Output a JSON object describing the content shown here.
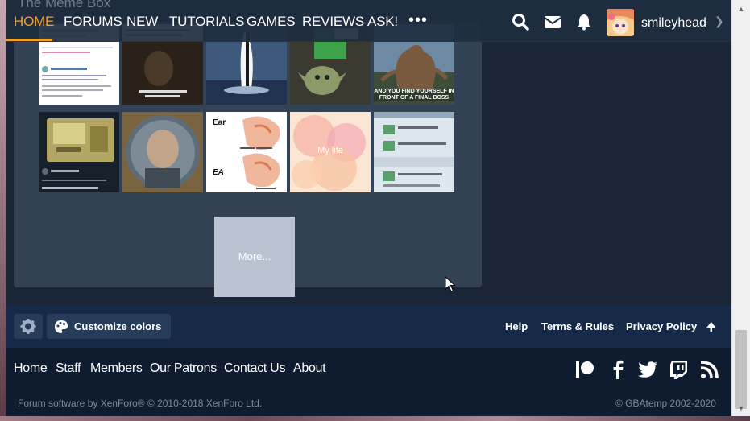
{
  "behind_title": "The Meme Box",
  "nav": {
    "items": [
      "HOME",
      "FORUMS",
      "NEW",
      "TUTORIALS",
      "GAMES",
      "REVIEWS",
      "ASK!"
    ],
    "more_glyph": "•••",
    "username": "smileyhead",
    "icons": [
      "search-icon",
      "envelope-icon",
      "bell-icon"
    ]
  },
  "panel": {
    "more_label": "More..."
  },
  "thumbnails": [
    {
      "name": "tweet-screenshot",
      "texts": [
        "The Shitkit Lit"
      ]
    },
    {
      "name": "potter-meme",
      "texts": [
        "Congratulations Ea. You have earned one star. Additional stars can be bought for $5,000 each.",
        "You dare use my own spells against me, Potter?"
      ]
    },
    {
      "name": "console-photo",
      "texts": []
    },
    {
      "name": "yoda-photo",
      "texts": []
    },
    {
      "name": "final-boss-meme",
      "texts": [
        "AND YOU FIND YOURSELF IN FRONT OF A FINAL BOSS"
      ]
    },
    {
      "name": "gameboy-tweet",
      "texts": [
        "James Howard",
        "There's an IC chip one out there"
      ]
    },
    {
      "name": "portrait-photo",
      "texts": []
    },
    {
      "name": "ea-ear-meme",
      "texts": [
        "Ear",
        "EA"
      ]
    },
    {
      "name": "my-life-image",
      "texts": [
        "My life"
      ]
    },
    {
      "name": "forum-screenshot",
      "texts": []
    }
  ],
  "footer": {
    "customize_label": "Customize colors",
    "links": [
      "Help",
      "Terms & Rules",
      "Privacy Policy"
    ],
    "bottom_links": [
      "Home",
      "Staff",
      "Members",
      "Our Patrons",
      "Contact Us",
      "About"
    ],
    "copyright_left": "Forum software by XenForo® © 2010-2018 XenForo Ltd.",
    "copyright_right": "© GBAtemp 2002-2020",
    "social_icons": [
      "patreon-icon",
      "facebook-icon",
      "twitter-icon",
      "twitch-icon",
      "rss-icon"
    ]
  },
  "colors": {
    "accent": "#f0a02c",
    "nav_bg": "#1e2c40",
    "panel_bg": "#344256",
    "footer_bar": "#162a48",
    "footer_bottom": "#0f1b2e"
  }
}
